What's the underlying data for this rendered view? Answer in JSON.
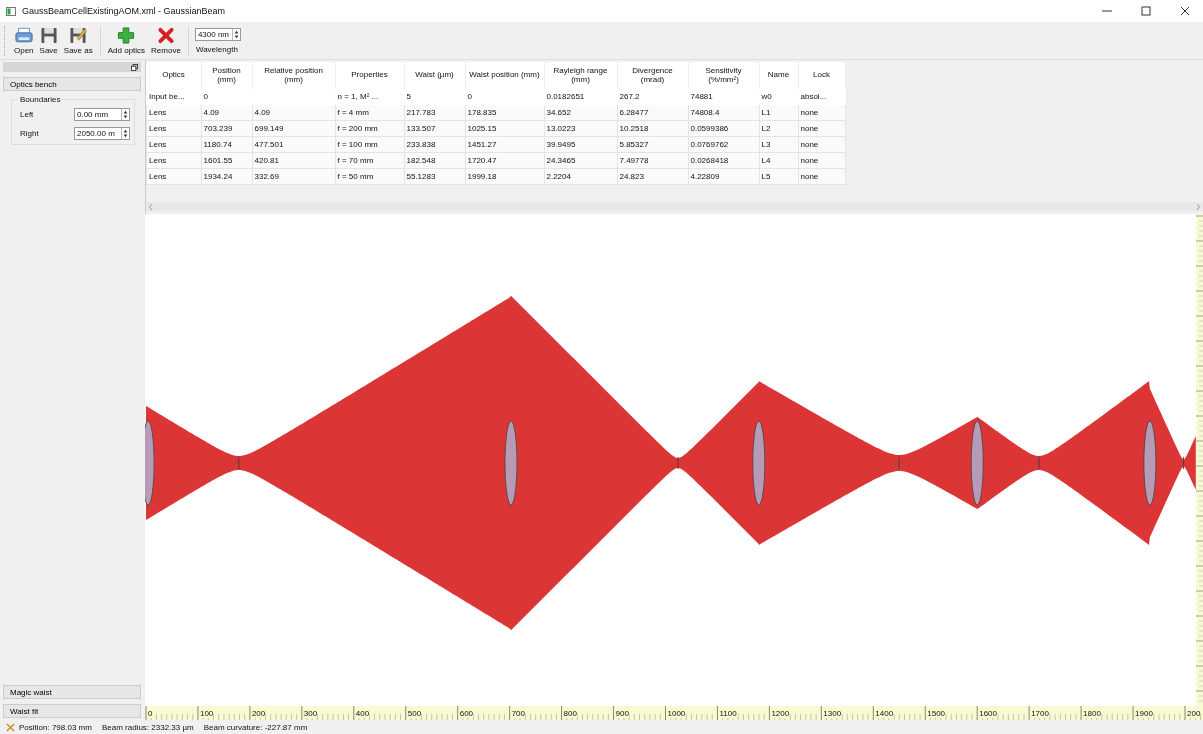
{
  "window": {
    "title": "GaussBeamCellExistingAOM.xml - GaussianBeam"
  },
  "toolbar": {
    "buttons": [
      {
        "kind": "open",
        "label": "Open"
      },
      {
        "kind": "save",
        "label": "Save"
      },
      {
        "kind": "save_as",
        "label": "Save as"
      },
      {
        "kind": "add",
        "label": "Add optics"
      },
      {
        "kind": "remove",
        "label": "Remove"
      }
    ],
    "wavelength": {
      "value": "4300 nm",
      "label": "Wavelength"
    }
  },
  "sidebar": {
    "optics_bench": "Optics bench",
    "boundaries": {
      "title": "Boundaries",
      "fields": [
        {
          "label": "Left",
          "value": "0.00 mm"
        },
        {
          "label": "Right",
          "value": "2050.00 m"
        }
      ]
    },
    "bottom_buttons": [
      "Magic waist",
      "Waist fit"
    ]
  },
  "table": {
    "columns": [
      "Optics",
      "Position (mm)",
      "Relative position (mm)",
      "Properties",
      "Waist (µm)",
      "Waist position (mm)",
      "Rayleigh range (mm)",
      "Divergence (mrad)",
      "Sensitivity (%/mm²)",
      "Name",
      "Lock"
    ],
    "rows": [
      {
        "kind": "input",
        "cells": [
          "Input be...",
          "0",
          null,
          "n = 1, M² ...",
          "5",
          "0",
          "0.0182651",
          "267.2",
          "74881",
          "w0",
          "absol..."
        ]
      },
      {
        "kind": "lens",
        "cells": [
          "Lens",
          "4.09",
          "4.09",
          "f = 4 mm",
          "217.783",
          "178.835",
          "34.652",
          "6.28477",
          "74808.4",
          "L1",
          "none"
        ]
      },
      {
        "kind": "lens",
        "cells": [
          "Lens",
          "703.239",
          "699.149",
          "f = 200 mm",
          "133.507",
          "1025.15",
          "13.0223",
          "10.2518",
          "0.0599386",
          "L2",
          "none"
        ]
      },
      {
        "kind": "lens",
        "cells": [
          "Lens",
          "1180.74",
          "477.501",
          "f = 100 mm",
          "233.838",
          "1451.27",
          "39.9495",
          "5.85327",
          "0.0769762",
          "L3",
          "none"
        ]
      },
      {
        "kind": "lens",
        "cells": [
          "Lens",
          "1601.55",
          "420.81",
          "f = 70 mm",
          "182.548",
          "1720.47",
          "24.3465",
          "7.49778",
          "0.0268418",
          "L4",
          "none"
        ]
      },
      {
        "kind": "lens",
        "cells": [
          "Lens",
          "1934.24",
          "332.69",
          "f = 50 mm",
          "55.1283",
          "1999.18",
          "2.2204",
          "24.823",
          "4.22809",
          "L5",
          "none"
        ]
      }
    ]
  },
  "ruler": {
    "labels": [
      "0",
      "100",
      "200",
      "300",
      "400",
      "500",
      "600",
      "700",
      "800",
      "900",
      "1000",
      "1100",
      "1200",
      "1300",
      "1400",
      "1500",
      "1600",
      "1700",
      "1800",
      "1900",
      "200"
    ]
  },
  "status_bar": {
    "position": "Position: 798.03 mm",
    "beam_radius": "Beam radius: 2332.33 µm",
    "beam_curvature": "Beam curvature: -227.87 mm"
  }
}
